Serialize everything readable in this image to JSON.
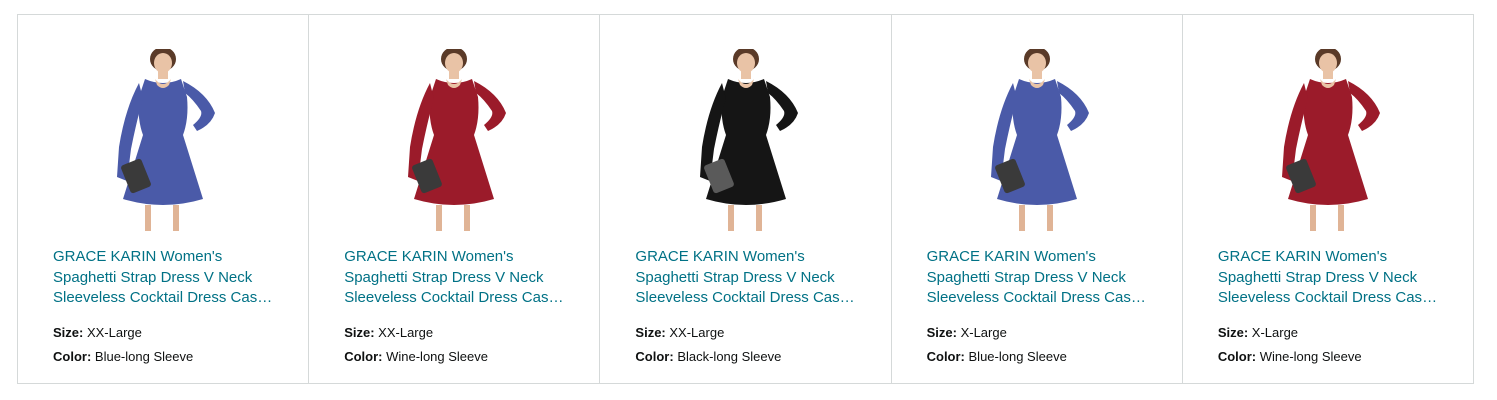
{
  "accent_link_color": "#007185",
  "products": [
    {
      "title": "GRACE KARIN Women's Spaghetti Strap Dress V Neck Sleeveless Cocktail Dress Casual Swing Dress",
      "size_label": "Size:",
      "size_value": "XX-Large",
      "color_label": "Color:",
      "color_value": "Blue-long Sleeve",
      "image": "dress-product-image",
      "dress_color": "#4a5aa8"
    },
    {
      "title": "GRACE KARIN Women's Spaghetti Strap Dress V Neck Sleeveless Cocktail Dress Casual Swing Dress",
      "size_label": "Size:",
      "size_value": "XX-Large",
      "color_label": "Color:",
      "color_value": "Wine-long Sleeve",
      "image": "dress-product-image",
      "dress_color": "#9b1b2a"
    },
    {
      "title": "GRACE KARIN Women's Spaghetti Strap Dress V Neck Sleeveless Cocktail Dress Casual Swing Dress",
      "size_label": "Size:",
      "size_value": "XX-Large",
      "color_label": "Color:",
      "color_value": "Black-long Sleeve",
      "image": "dress-product-image",
      "dress_color": "#151515"
    },
    {
      "title": "GRACE KARIN Women's Spaghetti Strap Dress V Neck Sleeveless Cocktail Dress Casual Swing Dress",
      "size_label": "Size:",
      "size_value": "X-Large",
      "color_label": "Color:",
      "color_value": "Blue-long Sleeve",
      "image": "dress-product-image",
      "dress_color": "#4a5aa8"
    },
    {
      "title": "GRACE KARIN Women's Spaghetti Strap Dress V Neck Sleeveless Cocktail Dress Casual Swing Dress",
      "size_label": "Size:",
      "size_value": "X-Large",
      "color_label": "Color:",
      "color_value": "Wine-long Sleeve",
      "image": "dress-product-image",
      "dress_color": "#9b1b2a"
    }
  ]
}
